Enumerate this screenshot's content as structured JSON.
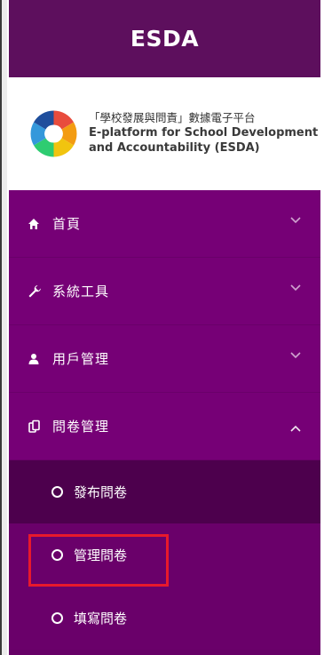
{
  "brand": {
    "title": "ESDA"
  },
  "logo": {
    "zh_title": "「學校發展與問責」數據電子平台",
    "en_line1": "E-platform for School Development",
    "en_line2": "and Accountability (ESDA)"
  },
  "menu": [
    {
      "label": "首頁",
      "icon": "home-icon",
      "state": "collapsed"
    },
    {
      "label": "系統工具",
      "icon": "wrench-icon",
      "state": "collapsed"
    },
    {
      "label": "用戶管理",
      "icon": "user-icon",
      "state": "collapsed"
    },
    {
      "label": "問卷管理",
      "icon": "clipboard-icon",
      "state": "expanded"
    }
  ],
  "submenu": [
    {
      "label": "發布問卷",
      "active": true
    },
    {
      "label": "管理問卷",
      "highlighted": true
    },
    {
      "label": "填寫問卷"
    }
  ],
  "colors": {
    "sidebar": "#760076",
    "brand_bar": "#5d0f5d",
    "sub_active": "#4d004d",
    "sub_normal": "#6a006a",
    "highlight": "#e8192c"
  }
}
